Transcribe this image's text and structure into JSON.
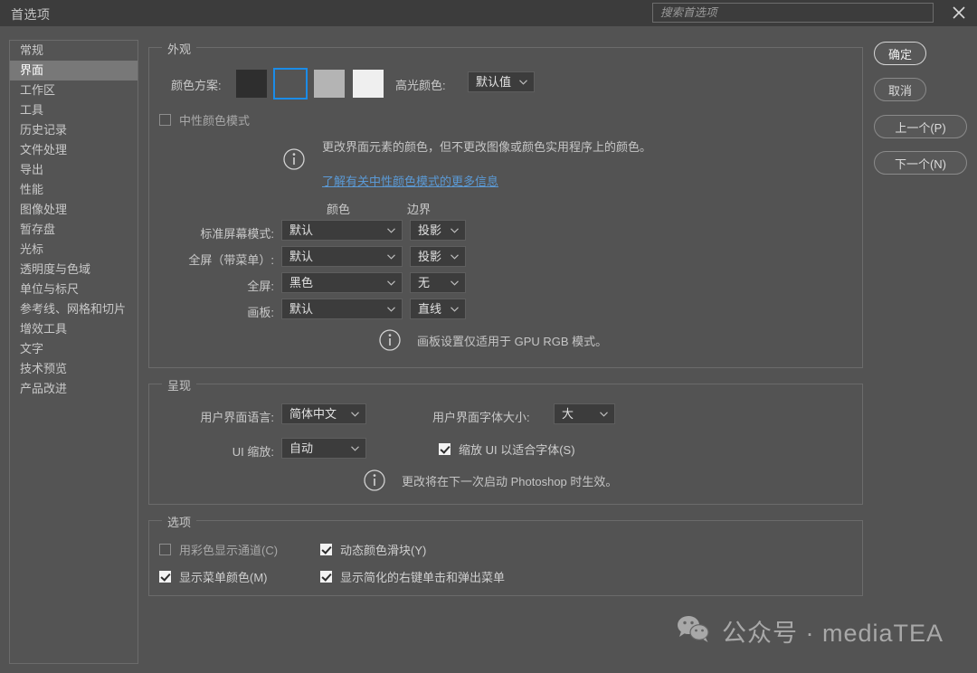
{
  "window": {
    "title": "首选项",
    "close_icon": "close-icon"
  },
  "search": {
    "placeholder": "搜索首选项",
    "value": ""
  },
  "sidebar": {
    "items": [
      {
        "label": "常规",
        "selected": false
      },
      {
        "label": "界面",
        "selected": true
      },
      {
        "label": "工作区",
        "selected": false
      },
      {
        "label": "工具",
        "selected": false
      },
      {
        "label": "历史记录",
        "selected": false
      },
      {
        "label": "文件处理",
        "selected": false
      },
      {
        "label": "导出",
        "selected": false
      },
      {
        "label": "性能",
        "selected": false
      },
      {
        "label": "图像处理",
        "selected": false
      },
      {
        "label": "暂存盘",
        "selected": false
      },
      {
        "label": "光标",
        "selected": false
      },
      {
        "label": "透明度与色域",
        "selected": false
      },
      {
        "label": "单位与标尺",
        "selected": false
      },
      {
        "label": "参考线、网格和切片",
        "selected": false
      },
      {
        "label": "增效工具",
        "selected": false
      },
      {
        "label": "文字",
        "selected": false
      },
      {
        "label": "技术预览",
        "selected": false
      },
      {
        "label": "产品改进",
        "selected": false
      }
    ]
  },
  "appearance": {
    "legend": "外观",
    "color_theme_label": "颜色方案:",
    "swatches": [
      {
        "name": "theme-darkest",
        "color": "#2e2e2e",
        "selected": false
      },
      {
        "name": "theme-dark",
        "color": "#545454",
        "selected": true
      },
      {
        "name": "theme-light",
        "color": "#b4b4b4",
        "selected": false
      },
      {
        "name": "theme-lightest",
        "color": "#efefef",
        "selected": false
      }
    ],
    "highlight_color_label": "高光颜色:",
    "highlight_color_value": "默认值",
    "neutral_mode_label": "中性颜色模式",
    "neutral_mode_checked": false,
    "neutral_note": "更改界面元素的颜色，但不更改图像或颜色实用程序上的颜色。",
    "neutral_link": "了解有关中性颜色模式的更多信息",
    "col_color": "颜色",
    "col_border": "边界",
    "rows": [
      {
        "label": "标准屏幕模式:",
        "color": "默认",
        "border": "投影"
      },
      {
        "label": "全屏（带菜单）:",
        "color": "默认",
        "border": "投影"
      },
      {
        "label": "全屏:",
        "color": "黑色",
        "border": "无"
      },
      {
        "label": "画板:",
        "color": "默认",
        "border": "直线"
      }
    ],
    "gpu_note": "画板设置仅适用于 GPU RGB 模式。"
  },
  "presentation": {
    "legend": "呈现",
    "ui_language_label": "用户界面语言:",
    "ui_language_value": "简体中文",
    "ui_font_size_label": "用户界面字体大小:",
    "ui_font_size_value": "大",
    "ui_scaling_label": "UI 缩放:",
    "ui_scaling_value": "自动",
    "scale_ui_label": "缩放 UI 以适合字体(S)",
    "scale_ui_checked": true,
    "restart_note": "更改将在下一次启动 Photoshop 时生效。"
  },
  "options": {
    "legend": "选项",
    "items": [
      {
        "label": "用彩色显示通道(C)",
        "checked": false,
        "dim": true
      },
      {
        "label": "动态颜色滑块(Y)",
        "checked": true,
        "dim": false
      },
      {
        "label": "显示菜单颜色(M)",
        "checked": true,
        "dim": false
      },
      {
        "label": "显示简化的右键单击和弹出菜单",
        "checked": true,
        "dim": false
      }
    ]
  },
  "buttons": {
    "ok": "确定",
    "cancel": "取消",
    "prev": "上一个(P)",
    "next": "下一个(N)"
  },
  "watermark": {
    "text": "公众号 · mediaTEA",
    "icon": "wechat-icon"
  },
  "colors": {
    "dialog_bg": "#535353",
    "titlebar_bg": "#3c3c3c",
    "accent_blue": "#1b8ce8",
    "link_blue": "#5b9ad6",
    "selected_row": "#787878"
  }
}
